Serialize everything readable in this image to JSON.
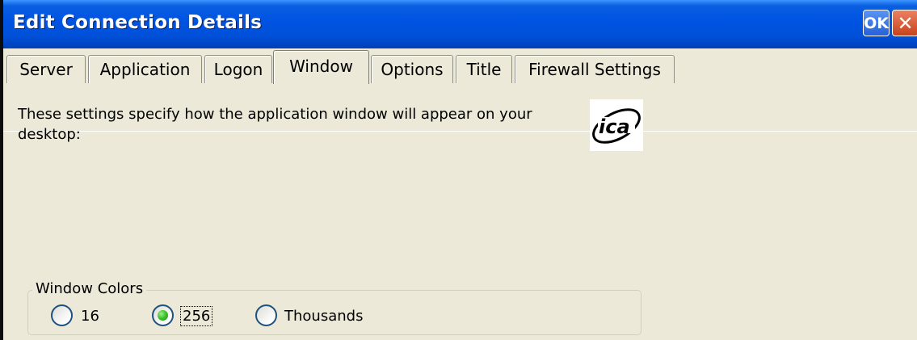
{
  "window": {
    "title": "Edit Connection Details",
    "ok_label": "OK",
    "close_glyph": "✕"
  },
  "tabs": [
    {
      "label": "Server"
    },
    {
      "label": "Application"
    },
    {
      "label": "Logon"
    },
    {
      "label": "Window",
      "active": true
    },
    {
      "label": "Options"
    },
    {
      "label": "Title"
    },
    {
      "label": "Firewall Settings"
    }
  ],
  "content": {
    "description": "These settings specify how the application window will appear on your desktop:",
    "logo_icon": "ica-logo-icon",
    "logo_text": "ica"
  },
  "window_colors": {
    "label": "Window Colors",
    "options": [
      {
        "label": "16",
        "selected": false
      },
      {
        "label": "256",
        "selected": true
      },
      {
        "label": "Thousands",
        "selected": false
      }
    ]
  },
  "colors": {
    "titlebar": "#0054e3",
    "background": "#ece9d8",
    "radio_selected": "#3fc52b"
  }
}
